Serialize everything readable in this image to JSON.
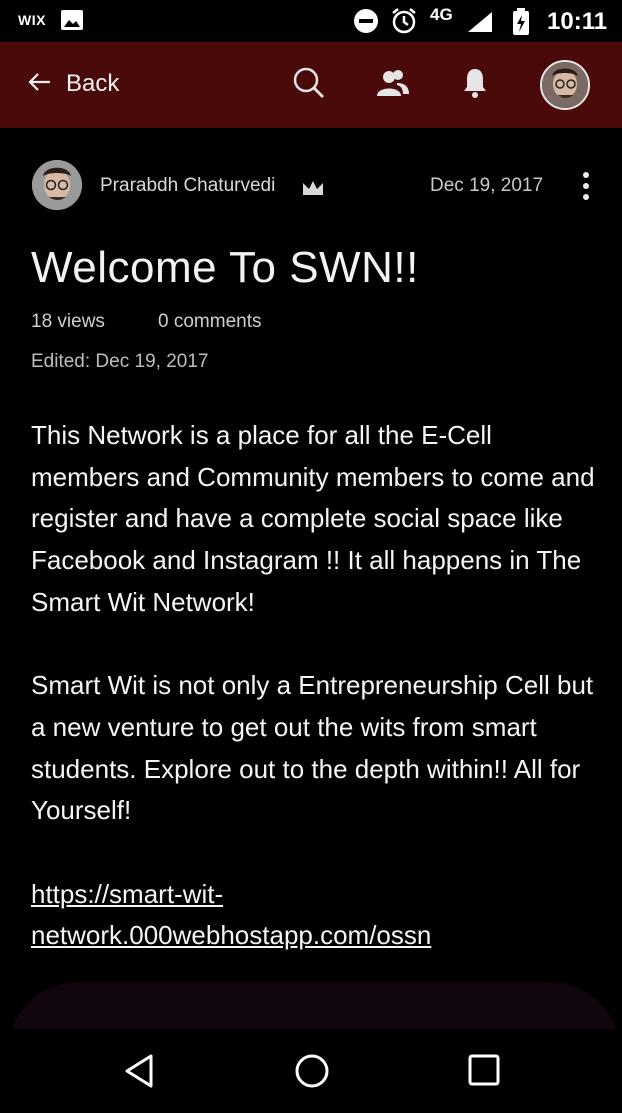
{
  "status_bar": {
    "app_label": "WIX",
    "network": "4G",
    "time": "10:11"
  },
  "app_bar": {
    "back_label": "Back",
    "icons": [
      "search-icon",
      "members-icon",
      "notifications-icon",
      "profile-avatar"
    ]
  },
  "post": {
    "author": "Prarabdh Chaturvedi",
    "date": "Dec 19, 2017",
    "title": "Welcome To SWN!!",
    "views": "18 views",
    "comments": "0 comments",
    "edited": "Edited: Dec 19, 2017",
    "paragraph1": "This Network is a place for all the E-Cell members and Community members to come and register and have a complete social space like Facebook and Instagram !! It all happens in The Smart Wit Network!",
    "paragraph2": "Smart Wit is not only a Entrepreneurship Cell but a new venture to get out the wits from smart students. Explore out to the depth within!! All for Yourself!",
    "link": "https://smart-wit-network.000webhostapp.com/ossn"
  },
  "colors": {
    "app_bar": "#4a0a0a",
    "background": "#000000"
  }
}
